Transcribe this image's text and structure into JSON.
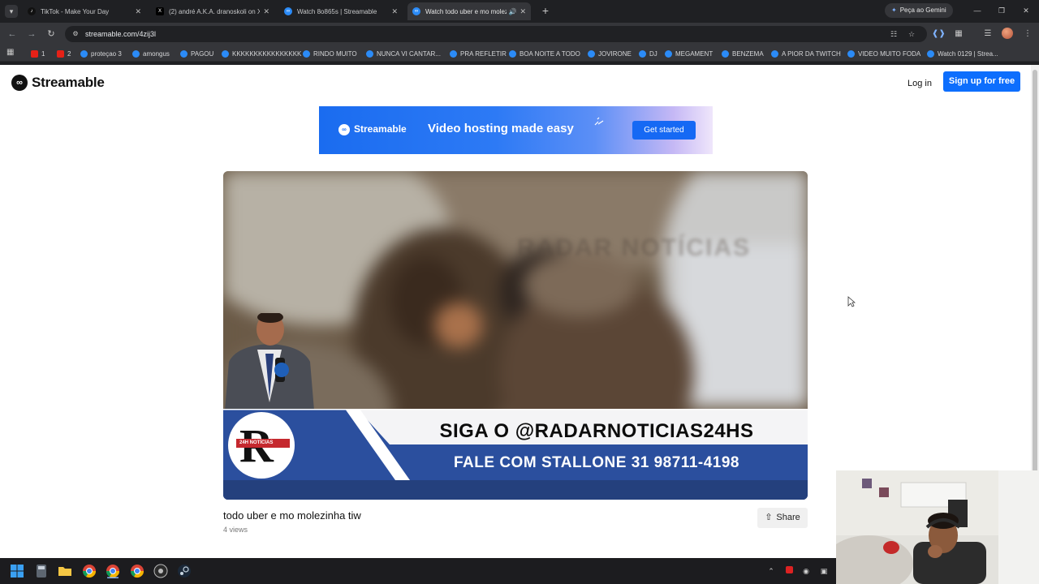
{
  "browser": {
    "tabs": [
      {
        "title": "TikTok - Make Your Day",
        "favicon": "tiktok-icon"
      },
      {
        "title": "(2) andré A.K.A. dranoskoli on X",
        "favicon": "x-icon"
      },
      {
        "title": "Watch 8o865s | Streamable",
        "favicon": "streamable-icon"
      },
      {
        "title": "Watch todo uber e mo molezinha tiw",
        "favicon": "streamable-icon"
      }
    ],
    "gemini_label": "Peça ao Gemini",
    "url": "streamable.com/4zij3l",
    "bookmarks": [
      "1",
      "2",
      "proteçao 3",
      "amongus",
      "PAGOU",
      "KKKKKKKKKKKKKKKK",
      "RINDO MUITO",
      "NUNCA VI CANTAR...",
      "PRA REFLETIR",
      "BOA NOITE A TODO",
      "JOVIRONE",
      "DJ",
      "MEGAMENT",
      "BENZEMA",
      "A PIOR DA TWITCH",
      "VIDEO MUITO FODA",
      "Watch 0129 | Strea..."
    ]
  },
  "site": {
    "brand": "Streamable",
    "login_label": "Log in",
    "signup_label": "Sign up for free",
    "banner": {
      "brand": "Streamable",
      "tagline": "Video hosting made easy",
      "cta": "Get started"
    },
    "video": {
      "watermark": "RADAR NOTÍCIAS",
      "overlay_line1": "SIGA O @RADARNOTICIAS24HS",
      "overlay_line2": "FALE COM STALLONE 31 98711-4198",
      "overlay_logo_letter": "R",
      "overlay_logo_band": "24H NOTÍCIAS",
      "title": "todo uber e mo molezinha tiw",
      "views": "4 views",
      "share_label": "Share"
    }
  },
  "colors": {
    "accent": "#0d6efd",
    "chrome_dark": "#1f2023",
    "chrome_toolbar": "#35363a",
    "lower_third_blue": "#2b4f9e"
  }
}
